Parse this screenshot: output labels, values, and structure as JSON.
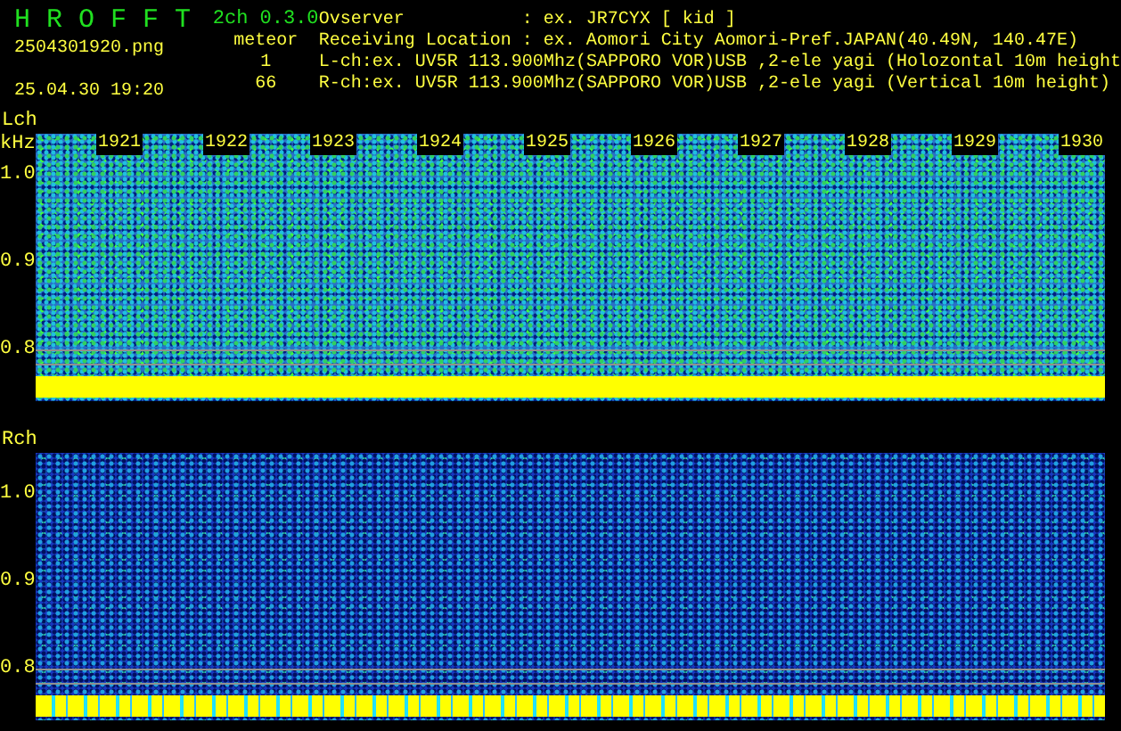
{
  "header": {
    "app_name": "H R O F F T",
    "version": "2ch 0.3.0",
    "file_name": "2504301920.png",
    "timestamp": "25.04.30 19:20",
    "meteor_label": "meteor",
    "meteor_counts": [
      "1",
      "66"
    ],
    "info": [
      {
        "label": "Ovserver",
        "value": ": ex. JR7CYX [ kid ]"
      },
      {
        "label": "Receiving Location",
        "value": ": ex. Aomori City Aomori-Pref.JAPAN(40.49N, 140.47E)"
      },
      {
        "label": "L-ch:",
        "value": "ex. UV5R 113.900Mhz(SAPPORO VOR)USB ,2-ele yagi (Holozontal 10m height"
      },
      {
        "label": "R-ch:",
        "value": "ex. UV5R 113.900Mhz(SAPPORO VOR)USB ,2-ele yagi (Vertical 10m height)"
      }
    ]
  },
  "panels": [
    {
      "kind": "left",
      "label": "Lch",
      "unit": "kHz",
      "time_labels": [
        "1921",
        "1922",
        "1923",
        "1924",
        "1925",
        "1926",
        "1927",
        "1928",
        "1929",
        "1930"
      ],
      "y_labels": [
        "1.0",
        "0.9",
        "0.8"
      ]
    },
    {
      "kind": "right",
      "label": "Rch",
      "y_labels": [
        "1.0",
        "0.9",
        "0.8"
      ]
    }
  ]
}
